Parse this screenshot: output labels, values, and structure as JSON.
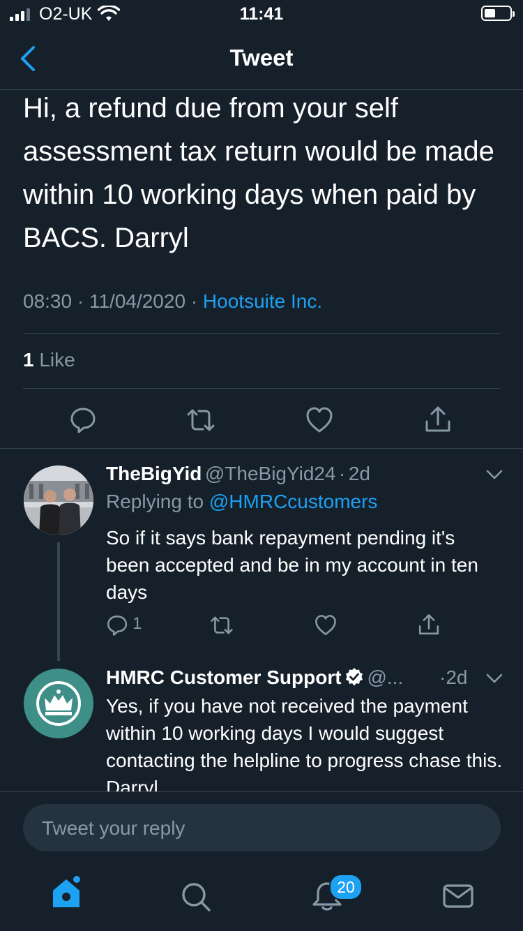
{
  "status_bar": {
    "carrier": "O2-UK",
    "time": "11:41"
  },
  "nav": {
    "title": "Tweet"
  },
  "main_tweet": {
    "text": "Hi, a refund due from your self assessment tax return would be made within 10 working days when paid by BACS. Darryl",
    "time": "08:30",
    "date": "11/04/2020",
    "source": "Hootsuite Inc.",
    "likes_count": "1",
    "likes_label": "Like"
  },
  "replies": [
    {
      "name": "TheBigYid",
      "handle": "@TheBigYid24",
      "age": "2d",
      "replying_prefix": "Replying to",
      "replying_to": "@HMRCcustomers",
      "text": "So if it says bank repayment pending  it's been accepted and be in my account in ten days",
      "reply_count": "1"
    },
    {
      "name": "HMRC Customer Support",
      "handle": "@...",
      "age": "2d",
      "text": "Yes, if you have not received the payment within 10 working days I would suggest contacting the helpline to progress chase this. Darryl",
      "verified": true
    }
  ],
  "composer": {
    "placeholder": "Tweet your reply"
  },
  "tab_bar": {
    "notifications_badge": "20"
  },
  "colors": {
    "background": "#15202b",
    "accent": "#1da1f2",
    "muted": "#8899a6",
    "divider": "#38444d"
  }
}
